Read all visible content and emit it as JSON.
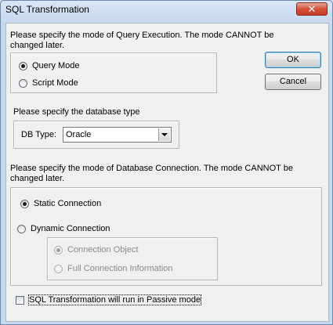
{
  "window": {
    "title": "SQL Transformation",
    "close_glyph": "✕"
  },
  "execution": {
    "prompt": "Please specify the mode of Query Execution. The mode CANNOT be changed later.",
    "options": [
      {
        "label": "Query Mode",
        "selected": true
      },
      {
        "label": "Script Mode",
        "selected": false
      }
    ]
  },
  "buttons": {
    "ok": "OK",
    "cancel": "Cancel"
  },
  "database": {
    "prompt": "Please specify the database type",
    "db_type_label": "DB Type:",
    "db_type_value": "Oracle"
  },
  "connection": {
    "prompt": "Please specify the mode of Database Connection. The mode CANNOT be changed later.",
    "static_label": "Static Connection",
    "static_selected": true,
    "dynamic_label": "Dynamic Connection",
    "dynamic_selected": false,
    "dynamic_options": [
      {
        "label": "Connection Object",
        "selected": true,
        "enabled": false
      },
      {
        "label": "Full Connection Information",
        "selected": false,
        "enabled": false
      }
    ]
  },
  "passive": {
    "label": "SQL Transformation will run in Passive mode",
    "checked": false
  }
}
